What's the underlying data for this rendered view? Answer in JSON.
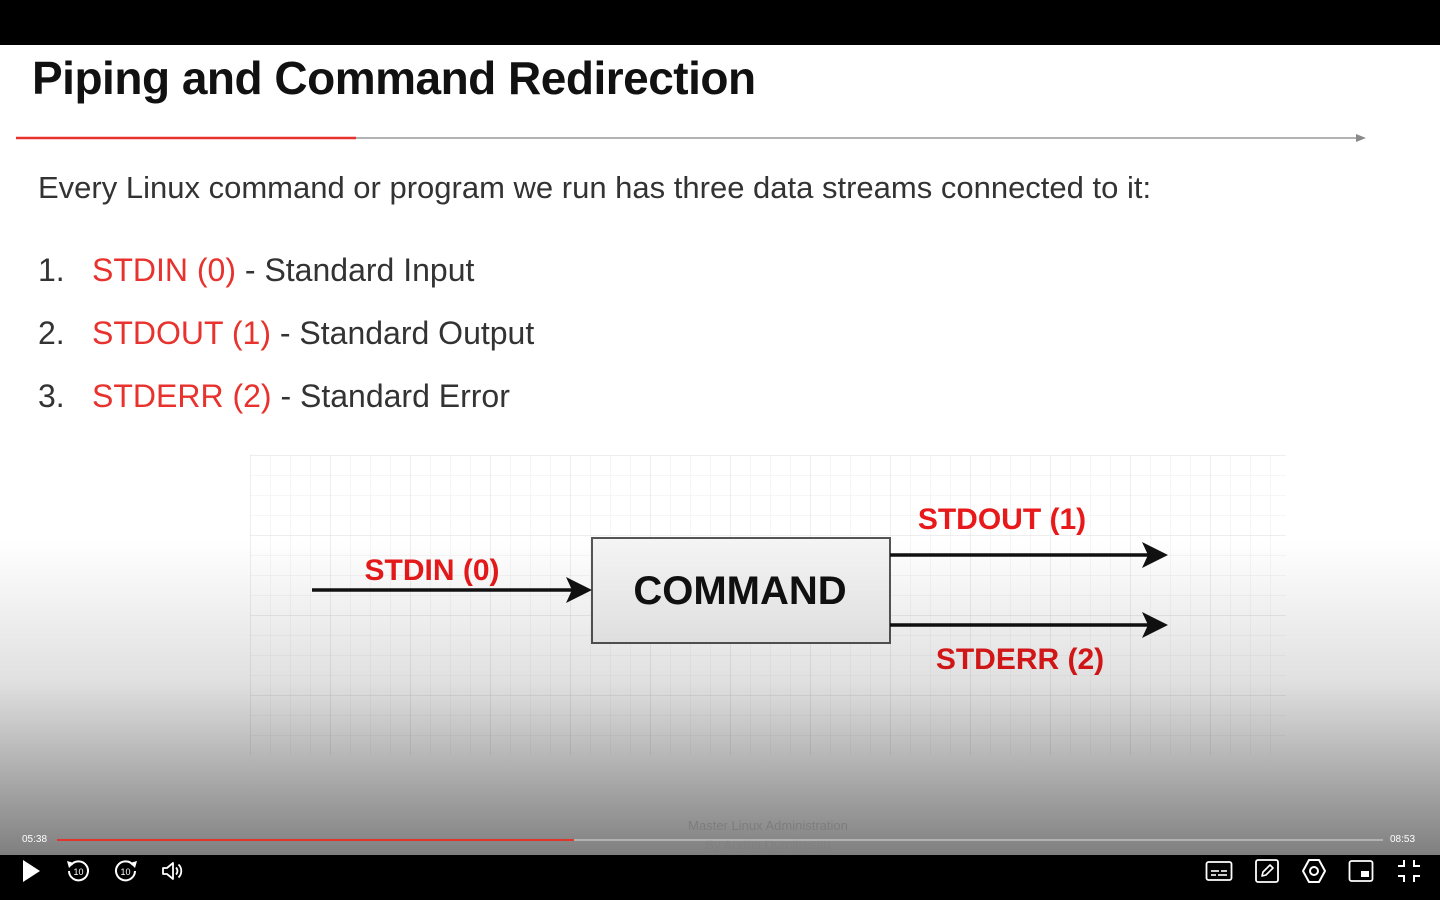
{
  "slide": {
    "title": "Piping and Command Redirection",
    "intro": "Every Linux command or program we run has three data streams connected to it:",
    "streams": [
      {
        "num": "1.",
        "name": "STDIN (0)",
        "desc": " - Standard Input"
      },
      {
        "num": "2.",
        "name": "STDOUT (1)",
        "desc": " - Standard Output"
      },
      {
        "num": "3.",
        "name": "STDERR (2)",
        "desc": " - Standard Error"
      }
    ],
    "diagram": {
      "command_label": "COMMAND",
      "stdin_label": "STDIN (0)",
      "stdout_label": "STDOUT (1)",
      "stderr_label": "STDERR (2)"
    },
    "watermark": {
      "line1": "Master Linux Administration",
      "line2": "By Andrei Dumitrescu"
    }
  },
  "player": {
    "current_time": "05:38",
    "total_time": "08:53",
    "progress_fraction": 0.39,
    "skip_seconds": "10",
    "icons": [
      "play-icon",
      "rewind-10-icon",
      "forward-10-icon",
      "volume-icon",
      "captions-icon",
      "notes-icon",
      "settings-icon",
      "picture-in-picture-icon",
      "exit-fullscreen-icon"
    ],
    "accent_color": "#e0352b"
  },
  "colors": {
    "stream_red": "#e8322d",
    "diagram_red": "#e8191a",
    "title_underline_red": "#e8322d"
  }
}
